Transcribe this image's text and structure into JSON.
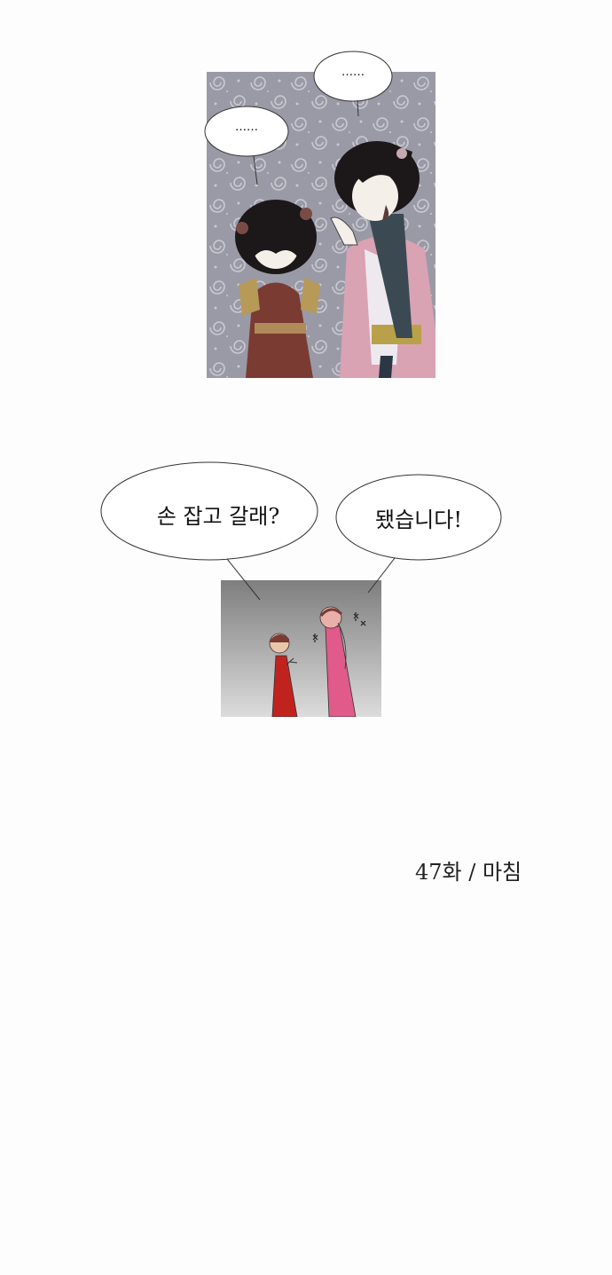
{
  "panel1": {
    "bubble_right": "……",
    "bubble_left": "……"
  },
  "panel2": {
    "bubble_left": "손 잡고 갈래?",
    "bubble_right": "됐습니다!"
  },
  "end_note": "47화 / 마침",
  "colors": {
    "page_bg": "#fdfdfd",
    "panel1_bg": "#9a9aa6",
    "robe_red": "#7a3b32",
    "robe_pink": "#d9a3b3",
    "panel2_bg_top": "#7e7e7e",
    "panel2_bg_bottom": "#dcdcdc"
  }
}
